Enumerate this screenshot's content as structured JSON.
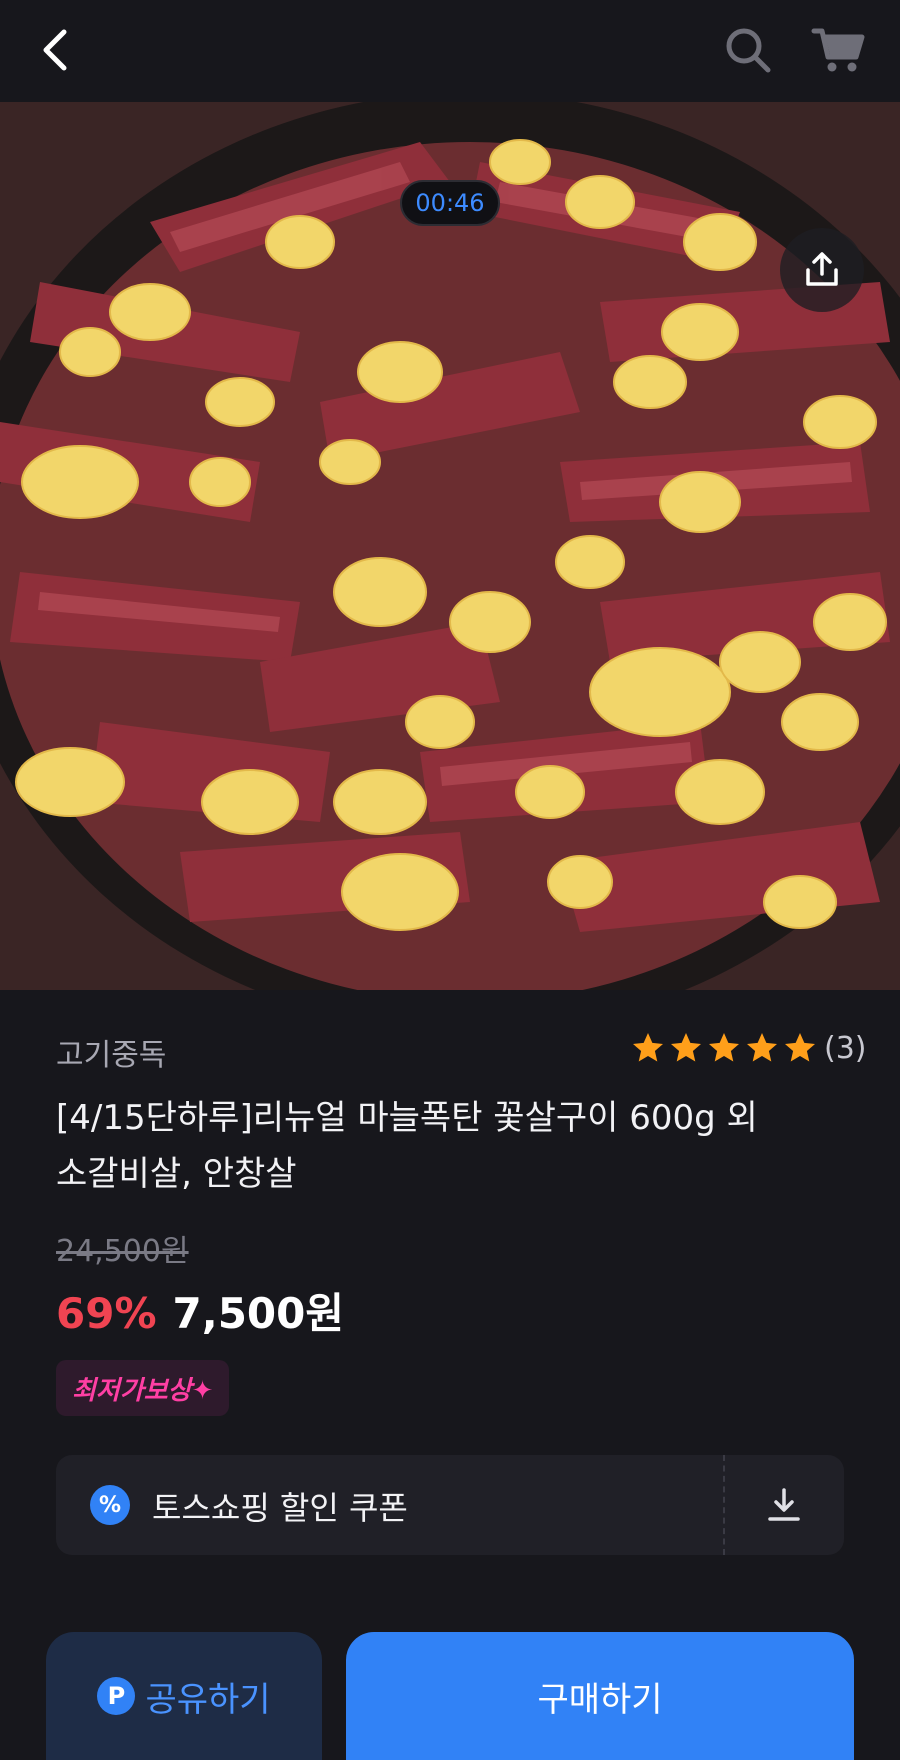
{
  "header": {
    "back_icon": "chevron-left-icon",
    "search_icon": "search-icon",
    "cart_icon": "cart-icon"
  },
  "media": {
    "timer": "00:46",
    "share_icon": "share-upload-icon"
  },
  "product": {
    "seller": "고기중독",
    "rating_stars": 5,
    "review_count": "(3)",
    "title_line1": "[4/15단하루]리뉴얼 마늘폭탄 꽃살구이 600g 외",
    "title_line2": "소갈비살, 안창살",
    "original_price": "24,500원",
    "discount": "69%",
    "price": "7,500원",
    "badge": "최저가보상✦"
  },
  "coupon": {
    "icon_text": "%",
    "label": "토스쇼핑 할인 쿠폰",
    "download_icon": "download-icon"
  },
  "actions": {
    "share_icon_text": "P",
    "share_label": "공유하기",
    "buy_label": "구매하기"
  },
  "colors": {
    "background": "#17171c",
    "accent_blue": "#3182f6",
    "discount_red": "#f04452",
    "star_orange": "#ff9f1a",
    "badge_pink": "#ff3fa4"
  }
}
